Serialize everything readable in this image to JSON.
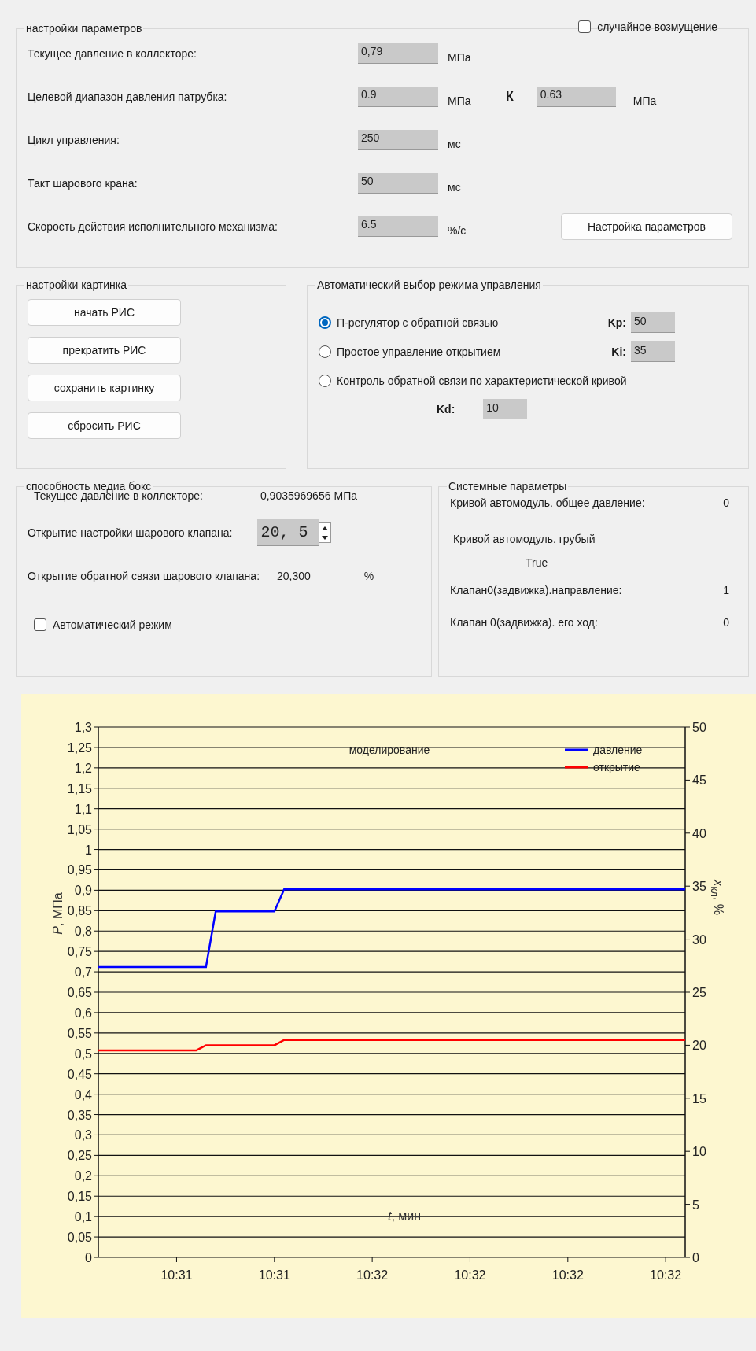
{
  "params": {
    "title": "настройки параметров",
    "rows": [
      {
        "label": "Текущее давление в коллекторе:",
        "value": "0,79",
        "unit": "МПа"
      },
      {
        "label": "Целевой диапазон давления патрубка:",
        "value": "0.9",
        "unit": "МПа"
      },
      {
        "label": "Цикл управления:",
        "value": "250",
        "unit": "мс"
      },
      {
        "label": "Такт шарового крана:",
        "value": "50",
        "unit": "мс"
      },
      {
        "label": "Скорость действия исполнительного механизма:",
        "value": "6.5",
        "unit": "%/с"
      }
    ],
    "random_disturbance": {
      "label": "случайное возмущение",
      "checked": false
    },
    "range_upper": {
      "label": "К",
      "value": "0.63",
      "unit": "МПа"
    },
    "settings_button": "Настройка параметров"
  },
  "picture_settings": {
    "title": "настройки картинка",
    "buttons": [
      "начать РИС",
      "прекратить РИС",
      "сохранить картинку",
      "сбросить РИС"
    ]
  },
  "mode_select": {
    "title": "Автоматический выбор режима управления",
    "options": [
      {
        "label": "П-регулятор с обратной связью",
        "selected": true,
        "gain_label": "Kp:",
        "gain_value": "50"
      },
      {
        "label": "Простое управление открытием",
        "selected": false,
        "gain_label": "Ki:",
        "gain_value": "35"
      },
      {
        "label": "Контроль обратной связи по характеристической кривой",
        "selected": false
      }
    ],
    "kd": {
      "label": "Kd:",
      "value": "10"
    }
  },
  "media_box": {
    "title": "способность медиа бокс",
    "current_pressure": {
      "label": "Текущее давление в коллекторе:",
      "value": "0,9035969656",
      "unit": "МПа"
    },
    "setpoint": {
      "label": "Открытие настройки шарового клапана:",
      "value": "20, 5"
    },
    "feedback": {
      "label": "Открытие обратной связи шарового клапана:",
      "value": "20,300",
      "unit": "%"
    },
    "auto_mode": {
      "label": "Автоматический режим",
      "checked": false
    }
  },
  "system_params": {
    "title": "Системные параметры",
    "items": [
      {
        "kind": "inline",
        "label": "Кривой автомодуль. общее давление:",
        "value": "0"
      },
      {
        "kind": "stacked",
        "label": "Кривой автомодуль. грубый",
        "value": "True"
      },
      {
        "kind": "inline",
        "label": "Клапан0(задвижка).направление:",
        "value": "1"
      },
      {
        "kind": "inline",
        "label": "Клапан 0(задвижка). его ход:",
        "value": "0"
      }
    ]
  },
  "chart": {
    "chart_data": {
      "type": "line",
      "title": "моделирование",
      "xlabel": "*t*, мин",
      "ylabel": "*P*, МПа",
      "y2label": "*x*$_{кл}$, %",
      "categories": [
        null,
        null,
        null,
        null,
        null,
        null,
        null,
        null,
        "10:31",
        null,
        null,
        null,
        null,
        null,
        null,
        null,
        null,
        null,
        "10:31",
        null,
        null,
        null,
        null,
        null,
        null,
        null,
        null,
        null,
        "10:32",
        null,
        null,
        null,
        null,
        null,
        null,
        null,
        null,
        null,
        "10:32",
        null,
        null,
        null,
        null,
        null,
        null,
        null,
        null,
        null,
        "10:32",
        null,
        null,
        null,
        null,
        null,
        null,
        null,
        null,
        null,
        "10:32",
        null,
        null
      ],
      "ylim": [
        0,
        1.3
      ],
      "y2lim": [
        0,
        50
      ],
      "grid": "y",
      "legend": "upper right",
      "yticks": [
        {
          "value": 0,
          "label": "0"
        },
        {
          "value": 0.05,
          "label": "0,05"
        },
        {
          "value": 0.1,
          "label": "0,1"
        },
        {
          "value": 0.15,
          "label": "0,15"
        },
        {
          "value": 0.2,
          "label": "0,2"
        },
        {
          "value": 0.25,
          "label": "0,25"
        },
        {
          "value": 0.3,
          "label": "0,3"
        },
        {
          "value": 0.35,
          "label": "0,35"
        },
        {
          "value": 0.4,
          "label": "0,4"
        },
        {
          "value": 0.45,
          "label": "0,45"
        },
        {
          "value": 0.5,
          "label": "0,5"
        },
        {
          "value": 0.55,
          "label": "0,55"
        },
        {
          "value": 0.6,
          "label": "0,6"
        },
        {
          "value": 0.65,
          "label": "0,65"
        },
        {
          "value": 0.7,
          "label": "0,7"
        },
        {
          "value": 0.75,
          "label": "0,75"
        },
        {
          "value": 0.8,
          "label": "0,8"
        },
        {
          "value": 0.85,
          "label": "0,85"
        },
        {
          "value": 0.9,
          "label": "0,9"
        },
        {
          "value": 0.95,
          "label": "0,95"
        },
        {
          "value": 1,
          "label": "1"
        },
        {
          "value": 1.05,
          "label": "1,05"
        },
        {
          "value": 1.1,
          "label": "1,1"
        },
        {
          "value": 1.15,
          "label": "1,15"
        },
        {
          "value": 1.2,
          "label": "1,2"
        },
        {
          "value": 1.25,
          "label": "1,25"
        },
        {
          "value": 1.3,
          "label": "1,3"
        }
      ],
      "y2ticks": [
        0,
        5,
        10,
        15,
        20,
        25,
        30,
        35,
        40,
        45,
        50
      ],
      "series": [
        {
          "name": "давление",
          "color": "#0000ff",
          "values": [
            0.712,
            0.712,
            0.712,
            0.712,
            0.712,
            0.712,
            0.712,
            0.712,
            0.712,
            0.712,
            0.712,
            0.712,
            0.848,
            0.848,
            0.848,
            0.848,
            0.848,
            0.848,
            0.848,
            0.902,
            0.902,
            0.902,
            0.902,
            0.902,
            0.902,
            0.902,
            0.902,
            0.902,
            0.902,
            0.902,
            0.902,
            0.902,
            0.902,
            0.902,
            0.902,
            0.902,
            0.902,
            0.902,
            0.902,
            0.902,
            0.902,
            0.902,
            0.902,
            0.902,
            0.902,
            0.902,
            0.902,
            0.902,
            0.902,
            0.902,
            0.902,
            0.902,
            0.902,
            0.902,
            0.902,
            0.902,
            0.902,
            0.902,
            0.902,
            0.902,
            0.902
          ]
        },
        {
          "name": "открытие",
          "color": "#ff0000",
          "axis": "y2",
          "values": [
            19.5,
            19.5,
            19.5,
            19.5,
            19.5,
            19.5,
            19.5,
            19.5,
            19.5,
            19.5,
            19.5,
            20.0,
            20.0,
            20.0,
            20.0,
            20.0,
            20.0,
            20.0,
            20.0,
            20.5,
            20.5,
            20.5,
            20.5,
            20.5,
            20.5,
            20.5,
            20.5,
            20.5,
            20.5,
            20.5,
            20.5,
            20.5,
            20.5,
            20.5,
            20.5,
            20.5,
            20.5,
            20.5,
            20.5,
            20.5,
            20.5,
            20.5,
            20.5,
            20.5,
            20.5,
            20.5,
            20.5,
            20.5,
            20.5,
            20.5,
            20.5,
            20.5,
            20.5,
            20.5,
            20.5,
            20.5,
            20.5,
            20.5,
            20.5,
            20.5,
            20.5
          ]
        }
      ]
    }
  }
}
